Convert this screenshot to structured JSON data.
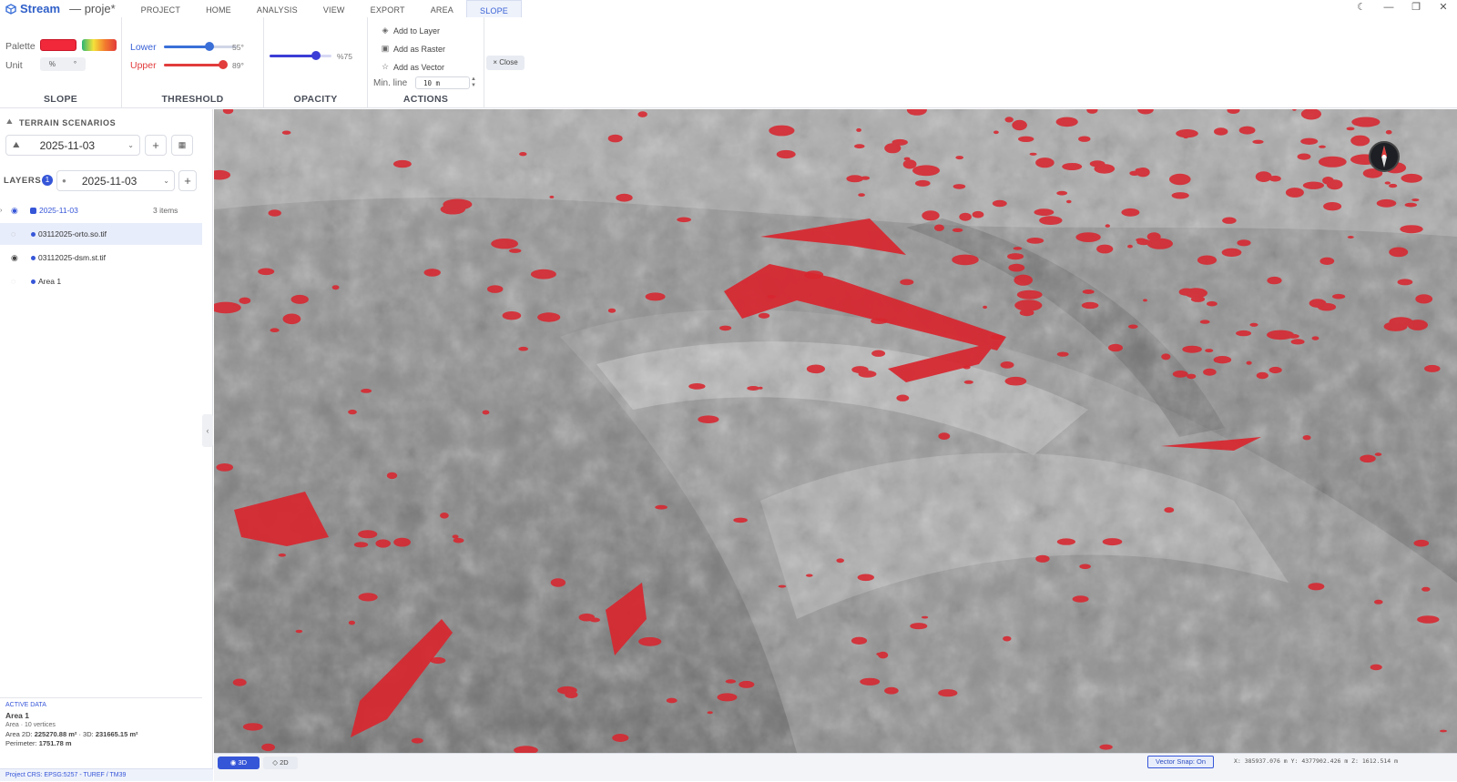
{
  "app": {
    "name": "Stream",
    "project": "— proje*"
  },
  "tabs": [
    "PROJECT",
    "HOME",
    "ANALYSIS",
    "VIEW",
    "EXPORT",
    "AREA",
    "SLOPE"
  ],
  "active_tab": "SLOPE",
  "window_controls": {
    "theme": "☾",
    "minimize": "—",
    "maximize": "❐",
    "close": "✕"
  },
  "ribbon": {
    "slope": {
      "title": "SLOPE",
      "palette_label": "Palette",
      "unit_label": "Unit",
      "unit_options": [
        "%",
        "°"
      ]
    },
    "threshold": {
      "title": "THRESHOLD",
      "lower_label": "Lower",
      "lower_value": "55°",
      "lower_fraction": 0.62,
      "upper_label": "Upper",
      "upper_value": "89°",
      "upper_fraction": 0.99
    },
    "opacity": {
      "title": "OPACITY",
      "value": "%75",
      "fraction": 0.75
    },
    "actions": {
      "title": "ACTIONS",
      "add_to_layer": "Add to Layer",
      "add_as_raster": "Add as Raster",
      "add_as_vector": "Add as Vector",
      "min_line_label": "Min. line",
      "min_line_value": "10 m"
    },
    "close_label": "× Close"
  },
  "colors": {
    "accent": "#3656d8",
    "slope_red": "#f0283a",
    "upper_red": "#e23c3c"
  },
  "sidebar": {
    "terrain_title": "TERRAIN SCENARIOS",
    "terrain_selected": "2025-11-03",
    "layers_title": "LAYERS",
    "layers_count": "1",
    "layers_selected": "2025-11-03",
    "items": [
      {
        "label": "2025-11-03",
        "meta": "3 items"
      },
      {
        "label": "03112025-orto.so.tif"
      },
      {
        "label": "03112025-dsm.st.tif"
      },
      {
        "label": "Area 1"
      }
    ]
  },
  "active_data": {
    "title": "ACTIVE DATA",
    "name": "Area 1",
    "sub": "Area · 10 vertices",
    "area_prefix": "Area 2D: ",
    "area_2d": "225270.88 m²",
    "area_sep": " · 3D: ",
    "area_3d": "231665.15 m²",
    "perimeter_prefix": "Perimeter: ",
    "perimeter": "1751.78 m"
  },
  "project_crs": "Project CRS: EPSG:5257 - TUREF / TM39",
  "bottom": {
    "view_3d": "3D",
    "view_2d": "2D",
    "vector_snap": "Vector Snap: On",
    "coords": "X: 385937.076 m Y: 4377902.426 m Z: 1612.514 m"
  }
}
